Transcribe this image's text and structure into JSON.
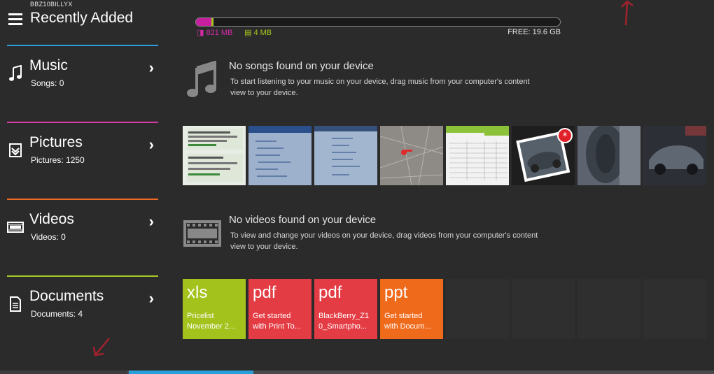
{
  "app": {
    "device_name": "BBZ10BILLYX",
    "title": "Recently Added"
  },
  "sidebar": {
    "items": [
      {
        "label": "Music",
        "count": "Songs: 0",
        "color": "#2f9fe0",
        "icon": "music-note-icon"
      },
      {
        "label": "Pictures",
        "count": "Pictures: 1250",
        "color": "#d63aa5",
        "icon": "pictures-icon"
      },
      {
        "label": "Videos",
        "count": "Videos: 0",
        "color": "#ef6a24",
        "icon": "film-icon"
      },
      {
        "label": "Documents",
        "count": "Documents: 4",
        "color": "#a7c62a",
        "icon": "document-icon"
      }
    ]
  },
  "storage": {
    "music_label": "821 MB",
    "docs_label": "4 MB",
    "free_label": "FREE: 19.6 GB",
    "music_color": "#c81fa0",
    "docs_color": "#a5c71f"
  },
  "music_empty": {
    "title": "No songs found on your device",
    "description": "To start listening to your music on your device, drag music from your computer's content view to your device."
  },
  "video_empty": {
    "title": "No videos found on your device",
    "description": "To view and change your videos on your device, drag videos from your computer's content view to your device."
  },
  "pictures": [
    {
      "kind": "chat-screenshot"
    },
    {
      "kind": "notebook-photo"
    },
    {
      "kind": "notebook-photo"
    },
    {
      "kind": "map"
    },
    {
      "kind": "spreadsheet"
    },
    {
      "kind": "car-badge"
    },
    {
      "kind": "car-dark"
    },
    {
      "kind": "car-night"
    }
  ],
  "documents": [
    {
      "ext": "xls",
      "name1": "Pricelist",
      "name2": "November 2...",
      "color": "#a4c21c"
    },
    {
      "ext": "pdf",
      "name1": "Get started",
      "name2": "with Print To...",
      "color": "#e43c44"
    },
    {
      "ext": "pdf",
      "name1": "BlackBerry_Z1",
      "name2": "0_Smartpho...",
      "color": "#e43c44"
    },
    {
      "ext": "ppt",
      "name1": "Get started",
      "name2": "with Docum...",
      "color": "#f06a1c"
    }
  ]
}
